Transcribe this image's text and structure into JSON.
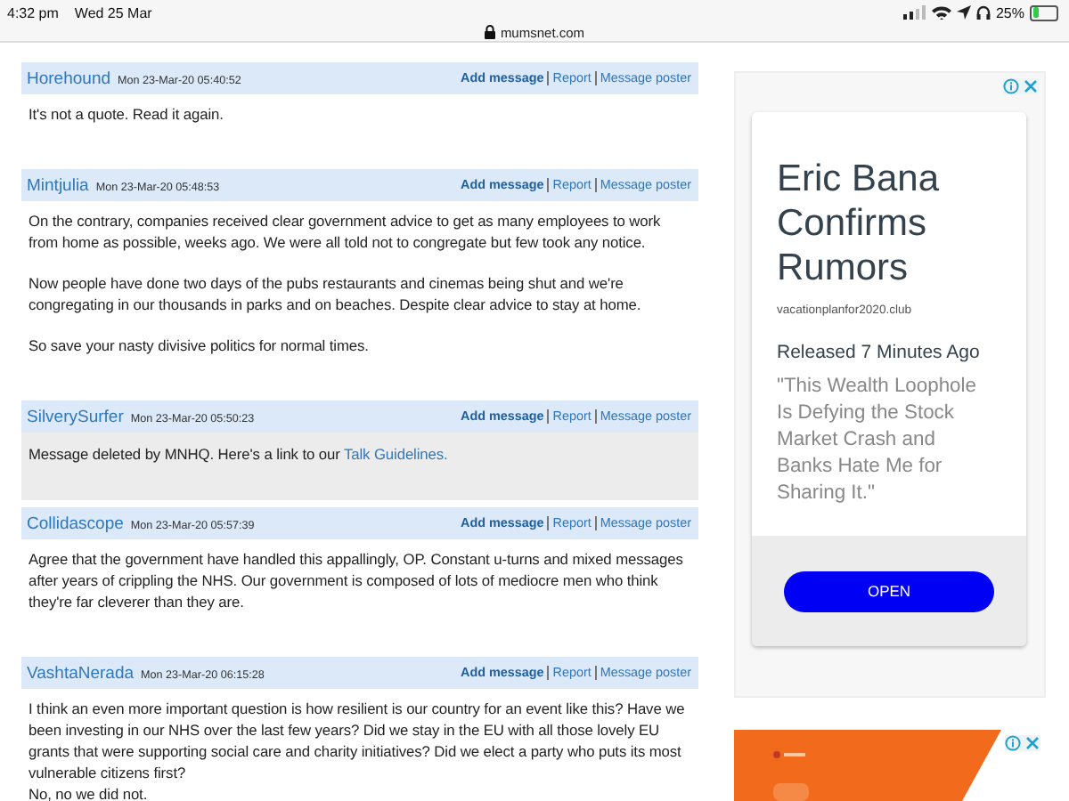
{
  "status_bar": {
    "time": "4:32 pm",
    "date": "Wed 25 Mar",
    "battery": "25%"
  },
  "address_bar": {
    "url": "mumsnet.com"
  },
  "posts": [
    {
      "author": "Horehound",
      "timestamp": "Mon 23-Mar-20 05:40:52",
      "actions": [
        "Add message",
        "Report",
        "Message poster"
      ],
      "deleted": false,
      "paragraphs": [
        "It's not a quote. Read it again."
      ]
    },
    {
      "author": "Mintjulia",
      "timestamp": "Mon 23-Mar-20 05:48:53",
      "actions": [
        "Add message",
        "Report",
        "Message poster"
      ],
      "deleted": false,
      "paragraphs": [
        "On the contrary, companies received clear government advice to get as many employees to work from home as possible, weeks ago. We were all told not to congregate but few took any notice.",
        "Now people have done two days of the pubs restaurants and cinemas being shut and we're congregating in our thousands in parks and on beaches. Despite clear advice to stay at home.",
        "So save your nasty divisive politics for normal times."
      ]
    },
    {
      "author": "SilverySurfer",
      "timestamp": "Mon 23-Mar-20 05:50:23",
      "actions": [
        "Add message",
        "Report",
        "Message poster"
      ],
      "deleted": true,
      "paragraphs": [
        "Message deleted by MNHQ. Here's a link to our"
      ],
      "link": "Talk Guidelines."
    },
    {
      "author": "Collidascope",
      "timestamp": "Mon 23-Mar-20 05:57:39",
      "actions": [
        "Add message",
        "Report",
        "Message poster"
      ],
      "deleted": false,
      "paragraphs": [
        "Agree that the government have handled this appallingly, OP. Constant u-turns and mixed messages after years of crippling the NHS. Our government is composed of lots of mediocre men who think they're far cleverer than they are."
      ]
    },
    {
      "author": "VashtaNerada",
      "timestamp": "Mon 23-Mar-20 06:15:28",
      "actions": [
        "Add message",
        "Report",
        "Message poster"
      ],
      "deleted": false,
      "paragraphs": [
        "I think an even more important question is how resilient is our country for an event like this? Have we been investing in our NHS over the last few years? Did we stay in the EU with all those lovely EU grants that were supporting social care and charity initiatives? Did we elect a party who puts its most vulnerable citizens first?\nNo, no we did not."
      ]
    }
  ],
  "ads": [
    {
      "kind": "card",
      "headline": "Eric Bana Confirms Rumors",
      "domain": "vacationplanfor2020.club",
      "subhead": "Released 7 Minutes Ago",
      "quote": "\"This Wealth Loophole Is Defying the Stock Market Crash and Banks Hate Me for Sharing It.\"",
      "button": "OPEN"
    },
    {
      "kind": "picture"
    }
  ]
}
